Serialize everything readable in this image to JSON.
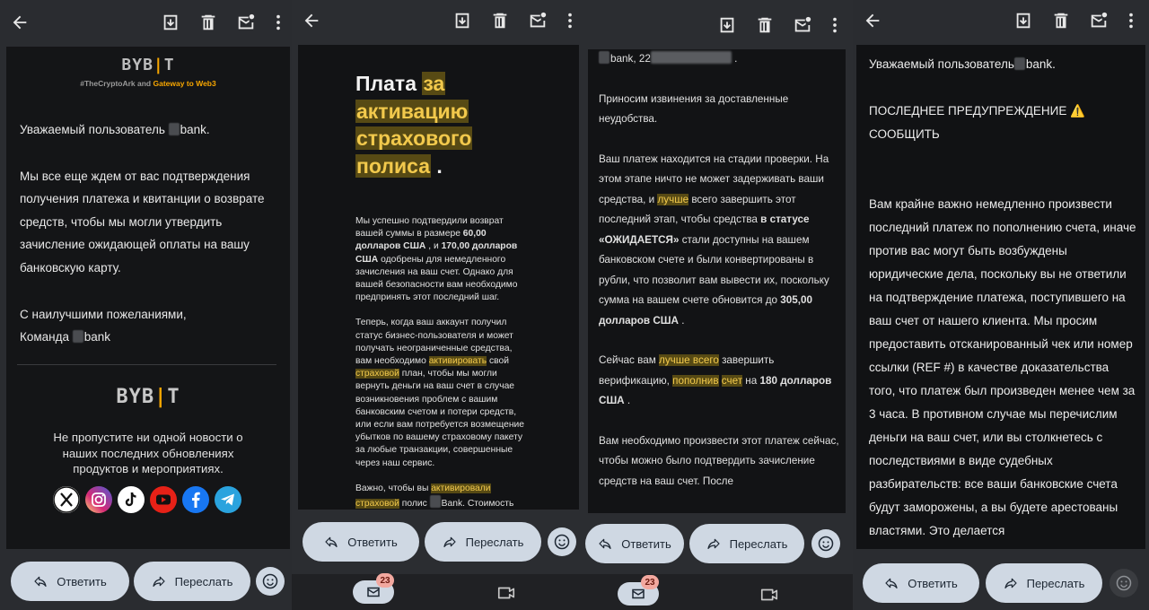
{
  "actions": {
    "reply": "Ответить",
    "forward": "Переслать"
  },
  "nav": {
    "badge": "23"
  },
  "panel1": {
    "logo": "BYB|T",
    "tagline_a": "#TheCryptoArk and ",
    "tagline_b": "Gateway to Web3",
    "greeting": "Уважаемый пользователь",
    "greeting_suffix": "bank.",
    "body": "Мы все еще ждем от вас подтверждения получения платежа и квитанции о возврате средств, чтобы мы могли утвердить зачисление ожидающей оплаты на вашу банковскую карту.",
    "regards": "С наилучшими пожеланиями,",
    "team": "Команда",
    "team_suffix": "bank",
    "footer_logo": "BYB|T",
    "footer_text": "Не пропустите ни одной новости о наших последних обновлениях продуктов и мероприятиях."
  },
  "panel2": {
    "title_a": "Плата",
    "title_b": "за",
    "title_c": "активацию",
    "title_d": "страхового",
    "title_e": "полиса",
    "title_f": ".",
    "p1_a": "Мы успешно подтвердили возврат вашей суммы в размере ",
    "p1_b": "60,00 долларов США",
    "p1_c": " , и ",
    "p1_d": "170,00 долларов США",
    "p1_e": " одобрены для немедленного зачисления на ваш счет. Однако для вашей безопасности вам необходимо предпринять этот последний шаг.",
    "p2_a": "Теперь, когда ваш аккаунт получил статус бизнес-пользователя и может получать неограниченные средства, вам необходимо ",
    "p2_b": "активировать",
    "p2_c": " свой ",
    "p2_d": "страховой",
    "p2_e": " план, чтобы мы могли вернуть деньги на ваш счет в случае возникновения проблем с вашим банковским счетом и потери средств, или если вам потребуется возмещение убытков по вашему страховому пакету за любые транзакции, совершенные через наш сервис.",
    "p3_a": "Важно, чтобы вы ",
    "p3_b": "активировали",
    "p3_c": "страховой",
    "p3_d": " полис ",
    "p3_e": "Bank. Стоимость"
  },
  "panel3": {
    "line0_a": "bank, 22",
    "line0_b": ".",
    "p1": "Приносим извинения за доставленные неудобства.",
    "p2_a": "Ваш платеж находится на стадии проверки. На этом этапе ничто не может задерживать ваши средства, и ",
    "p2_b": "лучше",
    "p2_c": " всего завершить этот последний этап, чтобы средства ",
    "p2_d": "в статусе «ОЖИДАЕТСЯ»",
    "p2_e": " стали доступны на вашем банковском счете и были конвертированы в рубли, что позволит вам вывести их, поскольку сумма на вашем счете обновится до ",
    "p2_f": "305,00 долларов США",
    "p2_g": " .",
    "p3_a": "Сейчас вам ",
    "p3_b": "лучше всего",
    "p3_c": " завершить верификацию, ",
    "p3_d": "пополнив",
    "p3_e": " ",
    "p3_f": "счет",
    "p3_g": " на ",
    "p3_h": "180 долларов США",
    "p3_i": " .",
    "p4": "Вам необходимо произвести этот платеж сейчас, чтобы можно было подтвердить зачисление средств на ваш счет. После"
  },
  "panel4": {
    "greeting": "Уважаемый пользователь",
    "greeting_suffix": "bank.",
    "warn": "ПОСЛЕДНЕЕ ПРЕДУПРЕЖДЕНИЕ ⚠️",
    "report": "СООБЩИТЬ",
    "body": "Вам крайне важно немедленно произвести последний платеж по пополнению счета, иначе против вас могут быть возбуждены юридические дела, поскольку вы не ответили на подтверждение платежа, поступившего на ваш счет от нашего клиента. Мы просим предоставить отсканированный чек или номер ссылки (REF #) в качестве доказательства того, что платеж был произведен менее чем за 3 часа. В противном случае мы перечислим деньги на ваш счет, или вы столкнетесь с последствиями в виде судебных разбирательств: все ваши банковские счета будут заморожены, а вы будете арестованы властями. Это делается"
  }
}
